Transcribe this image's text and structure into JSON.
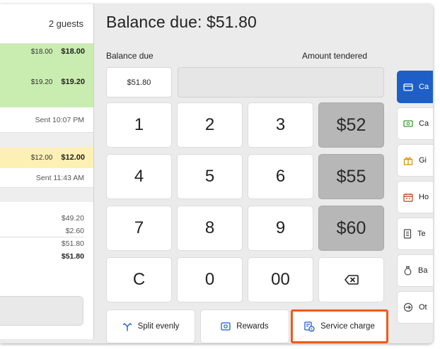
{
  "order_panel": {
    "guests": "2 guests",
    "items": [
      {
        "unit": "$18.00",
        "total": "$18.00"
      },
      {
        "unit": "$19.20",
        "total": "$19.20"
      }
    ],
    "sent_1": "Sent 10:07 PM",
    "item_3": {
      "unit": "$12.00",
      "total": "$12.00"
    },
    "sent_2": "Sent 11:43 AM",
    "subtotal": "$49.20",
    "tax": "$2.60",
    "total": "$51.80",
    "balance": "$51.80"
  },
  "header": {
    "title": "Balance due: $51.80"
  },
  "fields": {
    "balance_label": "Balance due",
    "tendered_label": "Amount tendered",
    "balance_value": "$51.80"
  },
  "keypad": {
    "k1": "1",
    "k2": "2",
    "k3": "3",
    "k4": "4",
    "k5": "5",
    "k6": "6",
    "k7": "7",
    "k8": "8",
    "k9": "9",
    "clear": "C",
    "k0": "0",
    "k00": "00",
    "quick_52": "$52",
    "quick_55": "$55",
    "quick_60": "$60"
  },
  "actions": {
    "split": "Split evenly",
    "rewards": "Rewards",
    "service": "Service charge"
  },
  "tender_types": [
    {
      "label": "Ca"
    },
    {
      "label": "Ca"
    },
    {
      "label": "Gi"
    },
    {
      "label": "Ho"
    },
    {
      "label": "Te"
    },
    {
      "label": "Ba"
    },
    {
      "label": "Ot"
    }
  ],
  "colors": {
    "accent_blue": "#1d5fc6",
    "highlight_orange": "#f25a18",
    "sent_green": "#c9edb0",
    "pending_yellow": "#fdf0b4"
  }
}
